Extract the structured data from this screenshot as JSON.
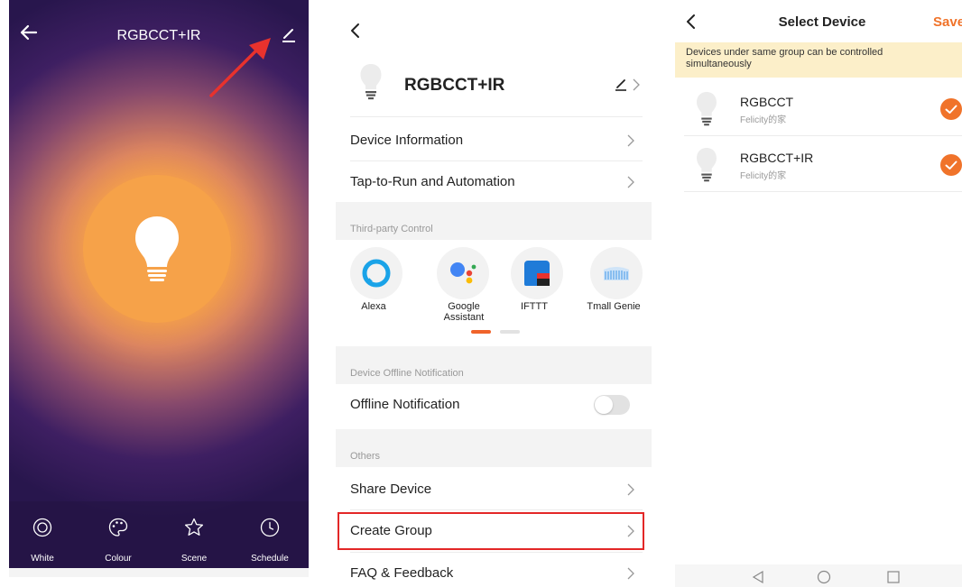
{
  "panel1": {
    "title": "RGBCCT+IR",
    "tabs": [
      {
        "label": "White",
        "icon": "white-mode-icon"
      },
      {
        "label": "Colour",
        "icon": "palette-icon"
      },
      {
        "label": "Scene",
        "icon": "star-icon"
      },
      {
        "label": "Schedule",
        "icon": "clock-icon"
      }
    ],
    "colors": {
      "bulb": "#f6a249",
      "background": "#28164d",
      "arrow": "#e8322d"
    }
  },
  "panel2": {
    "device_name": "RGBCCT+IR",
    "rows": {
      "device_info": "Device Information",
      "automation": "Tap-to-Run and Automation",
      "offline_notification": "Offline Notification",
      "share_device": "Share Device",
      "create_group": "Create Group",
      "faq": "FAQ & Feedback"
    },
    "sections": {
      "third_party": "Third-party Control",
      "offline": "Device Offline Notification",
      "others": "Others"
    },
    "third_party": [
      {
        "label": "Alexa",
        "icon": "alexa-icon"
      },
      {
        "label": "Google Assistant",
        "icon": "google-assistant-icon"
      },
      {
        "label": "IFTTT",
        "icon": "ifttt-icon"
      },
      {
        "label": "Tmall Genie",
        "icon": "tmall-genie-icon"
      }
    ],
    "offline_notification_enabled": false,
    "colors": {
      "highlight": "#e32727",
      "page_indicator": "#f0632a"
    }
  },
  "panel3": {
    "title": "Select Device",
    "save_label": "Save",
    "banner": "Devices under same group can be controlled simultaneously",
    "devices": [
      {
        "name": "RGBCCT",
        "home": "Felicity的家",
        "checked": true
      },
      {
        "name": "RGBCCT+IR",
        "home": "Felicity的家",
        "checked": true
      }
    ],
    "colors": {
      "accent": "#f0732a",
      "banner": "#fcefc9"
    }
  }
}
